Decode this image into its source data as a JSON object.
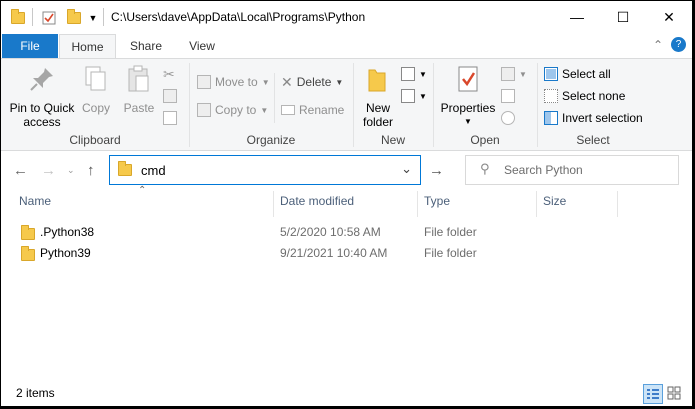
{
  "titlebar": {
    "path": "C:\\Users\\dave\\AppData\\Local\\Programs\\Python",
    "minimize": "—",
    "maximize": "☐",
    "close": "✕"
  },
  "tabs": [
    {
      "label": "File"
    },
    {
      "label": "Home"
    },
    {
      "label": "Share"
    },
    {
      "label": "View"
    }
  ],
  "ribbon": {
    "clipboard": {
      "pin": "Pin to Quick access",
      "pin_line1": "Pin to Quick",
      "pin_line2": "access",
      "copy": "Copy",
      "paste": "Paste",
      "label": "Clipboard"
    },
    "organize": {
      "move_to": "Move to",
      "copy_to": "Copy to",
      "delete": "Delete",
      "rename": "Rename",
      "label": "Organize"
    },
    "new": {
      "new_folder_line1": "New",
      "new_folder_line2": "folder",
      "label": "New"
    },
    "open": {
      "properties": "Properties",
      "label": "Open"
    },
    "select": {
      "select_all": "Select all",
      "select_none": "Select none",
      "invert": "Invert selection",
      "label": "Select"
    }
  },
  "address": {
    "value": "cmd",
    "search_placeholder": "Search Python"
  },
  "columns": {
    "name": "Name",
    "date": "Date modified",
    "type": "Type",
    "size": "Size"
  },
  "files": [
    {
      "name": ".Python38",
      "date": "5/2/2020 10:58 AM",
      "type": "File folder"
    },
    {
      "name": "Python39",
      "date": "9/21/2021 10:40 AM",
      "type": "File folder"
    }
  ],
  "status": {
    "count": "2 items"
  },
  "colors": {
    "accent": "#1979ca",
    "folder": "#f6c94b"
  }
}
